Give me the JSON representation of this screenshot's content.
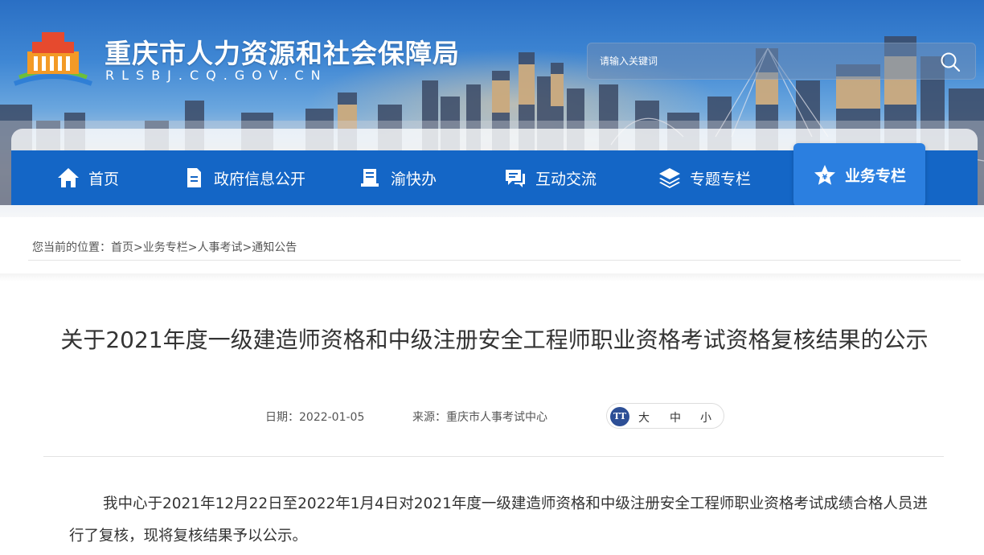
{
  "header": {
    "site_title": "重庆市人力资源和社会保障局",
    "site_domain": "RLSBJ.CQ.GOV.CN",
    "search_placeholder": "请输入关键词"
  },
  "nav": {
    "items": [
      {
        "label": "首页",
        "icon": "home-icon"
      },
      {
        "label": "政府信息公开",
        "icon": "document-icon"
      },
      {
        "label": "渝快办",
        "icon": "service-icon"
      },
      {
        "label": "互动交流",
        "icon": "chat-icon"
      },
      {
        "label": "专题专栏",
        "icon": "layers-icon"
      },
      {
        "label": "业务专栏",
        "icon": "star-icon",
        "active": true
      }
    ]
  },
  "breadcrumb": {
    "prefix": "您当前的位置：",
    "items": [
      "首页",
      "业务专栏",
      "人事考试",
      "通知公告"
    ],
    "separator": ">"
  },
  "article": {
    "title": "关于2021年度一级建造师资格和中级注册安全工程师职业资格考试资格复核结果的公示",
    "date_label": "日期：",
    "date": "2022-01-05",
    "source_label": "来源：",
    "source": "重庆市人事考试中心",
    "font_size_options": [
      "大",
      "中",
      "小"
    ],
    "font_icon_text": "TT",
    "body": "我中心于2021年12月22日至2022年1月4日对2021年度一级建造师资格和中级注册安全工程师职业资格考试成绩合格人员进行了复核，现将复核结果予以公示。"
  },
  "colors": {
    "nav_bg": "#1466c6",
    "nav_active_bg": "#2b7fe0",
    "text": "#333333",
    "font_icon_bg": "#2d4f96"
  }
}
